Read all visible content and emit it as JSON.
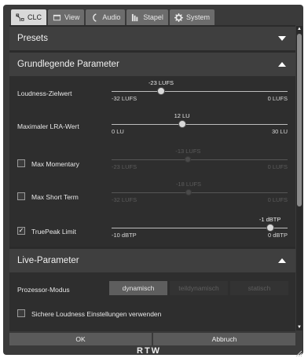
{
  "tabs": [
    {
      "label": "CLC",
      "icon": "clc-icon",
      "active": true
    },
    {
      "label": "View",
      "icon": "view-icon",
      "active": false
    },
    {
      "label": "Audio",
      "icon": "audio-icon",
      "active": false
    },
    {
      "label": "Stapel",
      "icon": "stapel-icon",
      "active": false
    },
    {
      "label": "System",
      "icon": "system-icon",
      "active": false
    }
  ],
  "presets": {
    "title": "Presets",
    "expanded": false
  },
  "basic": {
    "title": "Grundlegende Parameter",
    "expanded": true,
    "rows": [
      {
        "label": "Loudness-Zielwert",
        "has_checkbox": false,
        "checked": false,
        "enabled": true,
        "value_label": "-23 LUFS",
        "min_label": "-32 LUFS",
        "max_label": "0 LUFS",
        "min": -32,
        "max": 0,
        "value": -23
      },
      {
        "label": "Maximaler LRA-Wert",
        "has_checkbox": false,
        "checked": false,
        "enabled": true,
        "value_label": "12 LU",
        "min_label": "0 LU",
        "max_label": "30 LU",
        "min": 0,
        "max": 30,
        "value": 12
      },
      {
        "label": "Max Momentary",
        "has_checkbox": true,
        "checked": false,
        "enabled": false,
        "value_label": "-13 LUFS",
        "min_label": "-23 LUFS",
        "max_label": "0 LUFS",
        "min": -23,
        "max": 0,
        "value": -13
      },
      {
        "label": "Max Short Term",
        "has_checkbox": true,
        "checked": false,
        "enabled": false,
        "value_label": "-18 LUFS",
        "min_label": "-32 LUFS",
        "max_label": "0 LUFS",
        "min": -32,
        "max": 0,
        "value": -18
      },
      {
        "label": "TruePeak Limit",
        "has_checkbox": true,
        "checked": true,
        "enabled": true,
        "value_label": "-1 dBTP",
        "min_label": "-10 dBTP",
        "max_label": "0 dBTP",
        "min": -10,
        "max": 0,
        "value": -1
      }
    ]
  },
  "live": {
    "title": "Live-Parameter",
    "expanded": true,
    "mode_label": "Prozessor-Modus",
    "modes": [
      {
        "label": "dynamisch",
        "active": true
      },
      {
        "label": "teildynamisch",
        "active": false
      },
      {
        "label": "statisch",
        "active": false
      }
    ],
    "safe_label": "Sichere Loudness Einstellungen verwenden",
    "safe_checked": false
  },
  "buttons": {
    "ok": "OK",
    "cancel": "Abbruch"
  },
  "logo": "RTW"
}
